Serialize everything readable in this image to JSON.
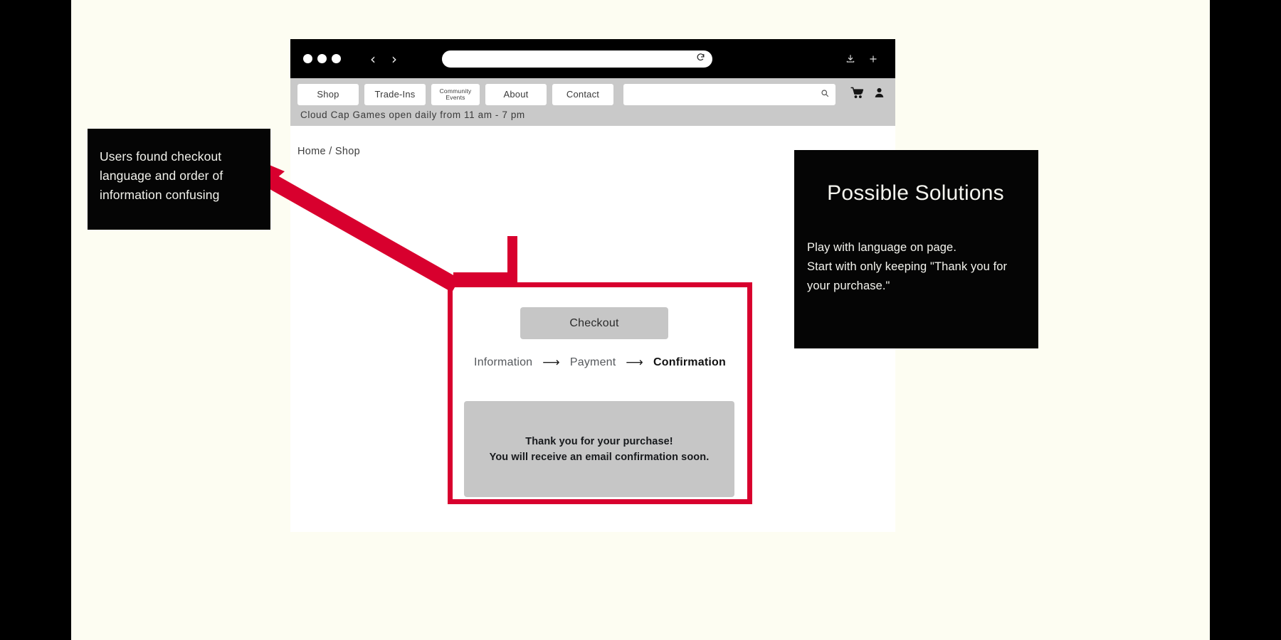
{
  "stage": {
    "background_color": "#fdfdf2",
    "letterbox_color": "#000000"
  },
  "browser": {
    "window_dots": [
      "",
      "",
      ""
    ],
    "back_label": "‹",
    "forward_label": "›",
    "url_value": "",
    "url_placeholder": "",
    "reload_icon": "reload-icon",
    "download_icon": "download-icon",
    "newtab_icon": "plus-icon"
  },
  "site": {
    "nav_items": [
      {
        "label": "Shop",
        "small": false
      },
      {
        "label": "Trade-Ins",
        "small": false
      },
      {
        "label": "Community\nEvents",
        "small": true
      },
      {
        "label": "About",
        "small": false
      },
      {
        "label": "Contact",
        "small": false
      }
    ],
    "search_value": "",
    "search_placeholder": "",
    "search_icon": "search-icon",
    "cart_icon": "cart-icon",
    "account_icon": "person-icon",
    "hours_banner": "Cloud Cap Games open daily from 11 am - 7 pm",
    "breadcrumb": "Home / Shop"
  },
  "checkout": {
    "highlight_color": "#D8002E",
    "button_label": "Checkout",
    "steps": [
      {
        "label": "Information",
        "active": false
      },
      {
        "label": "Payment",
        "active": false
      },
      {
        "label": "Confirmation",
        "active": true
      }
    ],
    "step_arrow": "⟶",
    "confirmation_line_1": "Thank you for your purchase!",
    "confirmation_line_2": "You will receive an email confirmation soon."
  },
  "annotations": {
    "left_callout": "Users found checkout language and order of information confusing",
    "arrow_color": "#D8002E"
  },
  "solutions": {
    "title": "Possible Solutions",
    "body": "Play with language on page.\nStart with only  keeping  \"Thank you for your purchase.\""
  }
}
